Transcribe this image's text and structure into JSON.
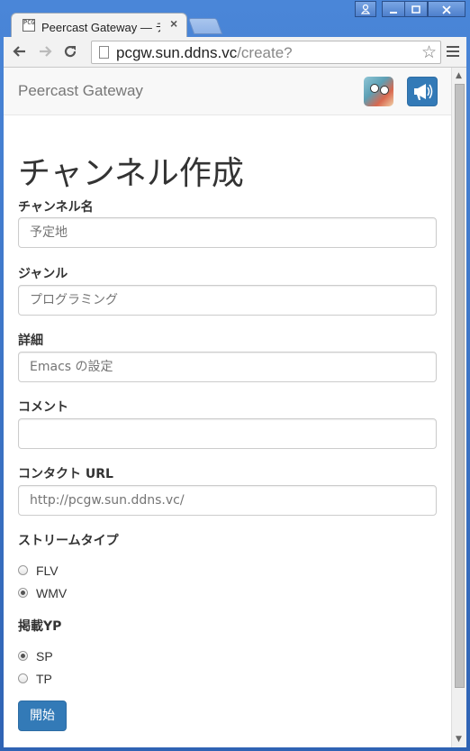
{
  "browser": {
    "tab_title": "Peercast Gateway — チ",
    "tab_close": "×",
    "favicon_text": "PCGW",
    "url_host": "pcgw.sun.ddns.vc",
    "url_path": "/create?",
    "window_buttons": [
      "user",
      "minimize",
      "maximize",
      "close"
    ],
    "icons": [
      "back-arrow-icon",
      "forward-arrow-icon",
      "reload-icon",
      "star-icon",
      "menu-icon"
    ]
  },
  "navbar": {
    "brand": "Peercast Gateway"
  },
  "page": {
    "title": "チャンネル作成",
    "fields": [
      {
        "label": "チャンネル名",
        "value": ""
      },
      {
        "label": "ジャンル",
        "value": ""
      },
      {
        "label": "詳細",
        "value": ""
      },
      {
        "label": "コメント",
        "value": ""
      },
      {
        "label": "コンタクト URL",
        "value": ""
      }
    ],
    "placeholders": [
      "予定地",
      "プログラミング",
      "Emacs の設定",
      "",
      "http://pcgw.sun.ddns.vc/"
    ],
    "stream_type": {
      "label": "ストリームタイプ",
      "options": [
        "FLV",
        "WMV"
      ],
      "selected": "WMV"
    },
    "yp": {
      "label": "掲載YP",
      "options": [
        "SP",
        "TP"
      ],
      "selected": "SP"
    },
    "submit": "開始"
  },
  "colors": {
    "primary": "#337ab7",
    "window_frame": "#3b6fbe"
  }
}
